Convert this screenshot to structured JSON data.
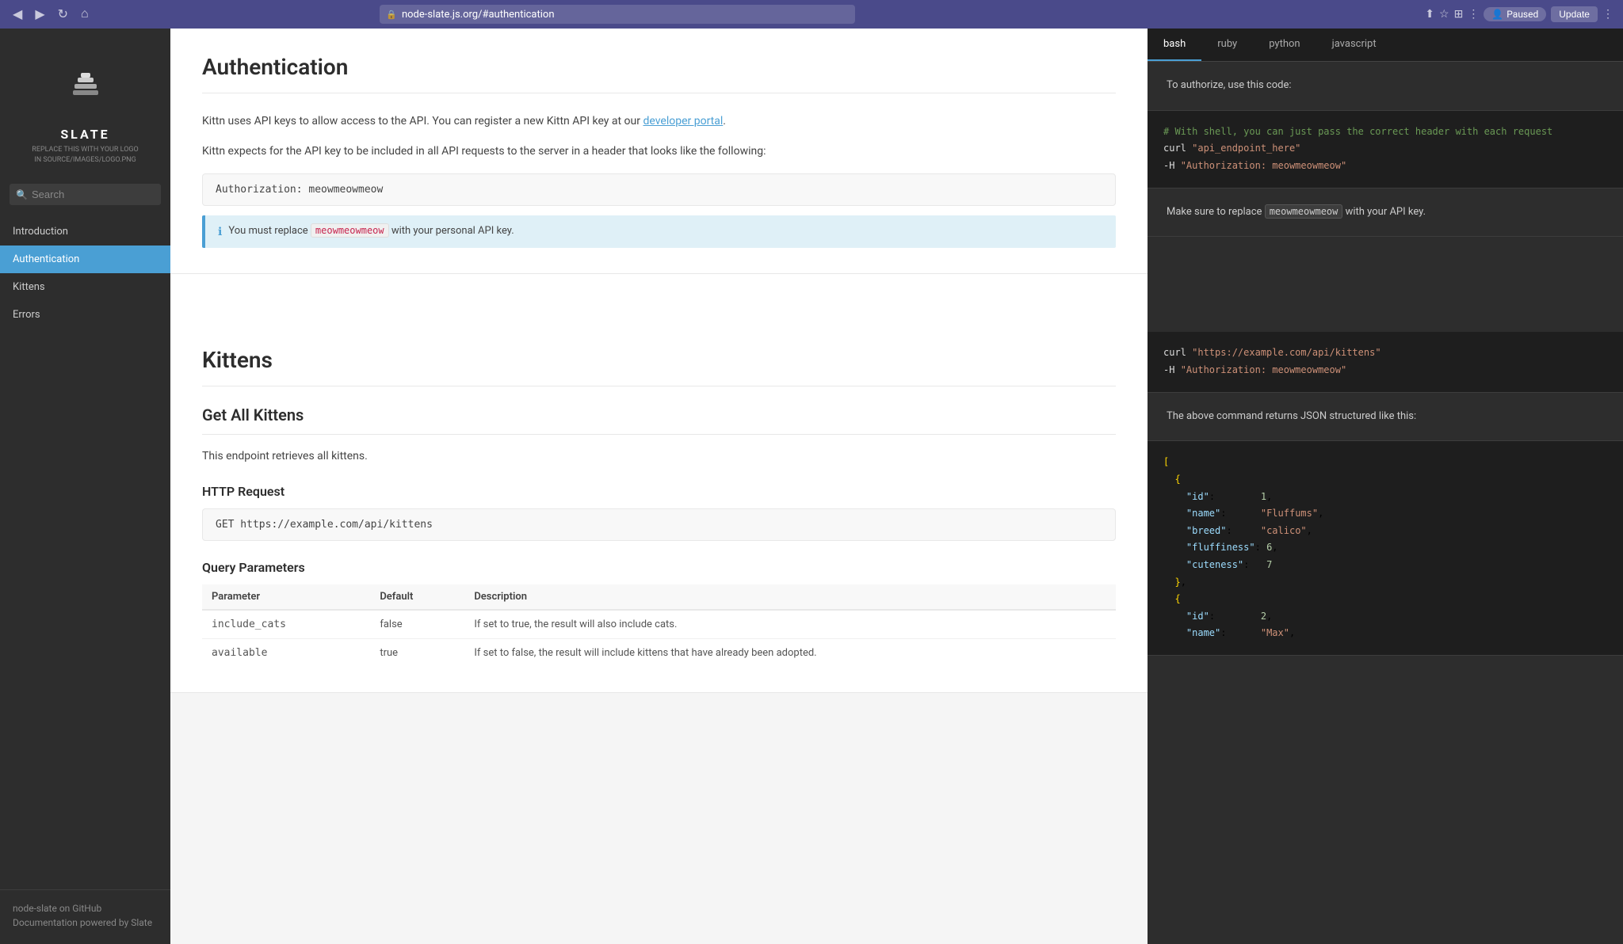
{
  "browser": {
    "url": "node-slate.js.org/#authentication",
    "paused_label": "Paused",
    "update_label": "Update",
    "back": "◀",
    "forward": "▶",
    "refresh": "↻",
    "home": "⌂"
  },
  "sidebar": {
    "logo_name": "SLATE",
    "logo_subtitle": "REPLACE THIS WITH YOUR LOGO\nIN SOURCE/IMAGES/LOGO.PNG",
    "search_placeholder": "Search",
    "nav_items": [
      {
        "id": "introduction",
        "label": "Introduction",
        "active": false
      },
      {
        "id": "authentication",
        "label": "Authentication",
        "active": true
      },
      {
        "id": "kittens",
        "label": "Kittens",
        "active": false
      },
      {
        "id": "errors",
        "label": "Errors",
        "active": false
      }
    ],
    "github_link": "node-slate on GitHub",
    "powered_by": "Documentation powered by Slate"
  },
  "lang_tabs": [
    {
      "id": "bash",
      "label": "bash",
      "active": true
    },
    {
      "id": "ruby",
      "label": "ruby",
      "active": false
    },
    {
      "id": "python",
      "label": "python",
      "active": false
    },
    {
      "id": "javascript",
      "label": "javascript",
      "active": false
    }
  ],
  "auth_section": {
    "heading": "Authentication",
    "para1_start": "Kittn uses API keys to allow access to the API. You can register a new Kittn API key at our ",
    "para1_link": "developer portal",
    "para1_end": ".",
    "para2": "Kittn expects for the API key to be included in all API requests to the server in a header that looks like the following:",
    "code_example": "Authorization: meowmeowmeow",
    "info_text_start": "You must replace ",
    "info_code": "meowmeowmeow",
    "info_text_end": " with your personal API key."
  },
  "right_auth": {
    "authorize_label": "To authorize, use this code:",
    "code_comment": "# With shell, you can just pass the correct header with each request",
    "code_line1_cmd": "curl ",
    "code_line1_str": "\"api_endpoint_here\"",
    "code_line2": "  -H ",
    "code_line2_str": "\"Authorization: meowmeowmeow\"",
    "replace_label_start": "Make sure to replace ",
    "replace_code": "meowmeowmeow",
    "replace_label_end": " with your API key."
  },
  "kittens_section": {
    "heading": "Kittens",
    "get_all_heading": "Get All Kittens",
    "get_all_desc": "This endpoint retrieves all kittens.",
    "http_req_heading": "HTTP Request",
    "http_req_code": "GET https://example.com/api/kittens",
    "query_params_heading": "Query Parameters",
    "table_headers": [
      "Parameter",
      "Default",
      "Description"
    ],
    "table_rows": [
      {
        "param": "include_cats",
        "default": "false",
        "desc": "If set to true, the result will also include cats."
      },
      {
        "param": "available",
        "default": "true",
        "desc": "If set to false, the result will include kittens that have already been adopted."
      }
    ]
  },
  "right_kittens": {
    "curl_line1_cmd": "curl ",
    "curl_line1_str": "\"https://example.com/api/kittens\"",
    "curl_line2": "  -H ",
    "curl_line2_str": "\"Authorization: meowmeowmeow\"",
    "json_label": "The above command returns JSON structured like this:",
    "json_code": "[\n  {\n    \"id\":        1,\n    \"name\":      \"Fluffums\",\n    \"breed\":     \"calico\",\n    \"fluffiness\": 6,\n    \"cuteness\":  7\n  },\n  {\n    \"id\":        2,\n    \"name\":      \"Max\","
  }
}
